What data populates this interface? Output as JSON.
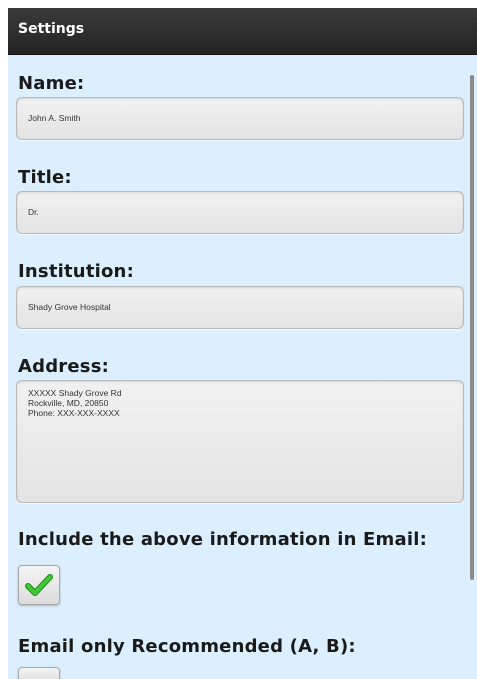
{
  "header": {
    "title": "Settings"
  },
  "form": {
    "name": {
      "label": "Name:",
      "value": "John A. Smith"
    },
    "title": {
      "label": "Title:",
      "value": "Dr."
    },
    "institution": {
      "label": "Institution:",
      "value": "Shady Grove Hospital"
    },
    "address": {
      "label": "Address:",
      "value": "XXXXX Shady Grove Rd\nRockville, MD, 20850\nPhone: XXX-XXX-XXXX"
    },
    "include_info": {
      "label": "Include the above information in Email:",
      "checked": true
    },
    "email_recommended": {
      "label": "Email only Recommended (A, B):",
      "checked": false
    }
  },
  "colors": {
    "background": "#dcefff",
    "titlebar": "#2d2d2d",
    "check": "#3ec832"
  }
}
